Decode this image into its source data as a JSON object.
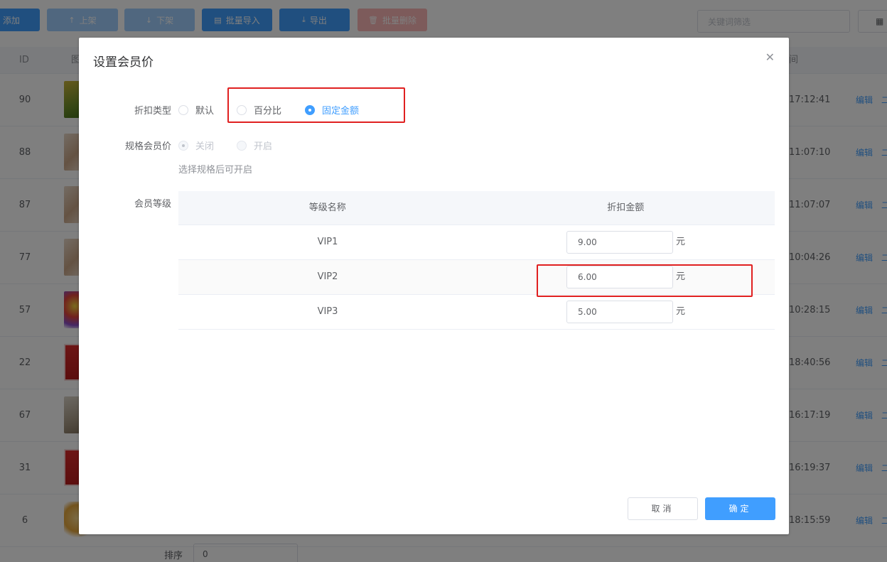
{
  "toolbar": {
    "add": "添加",
    "up": "上架",
    "down": "下架",
    "import": "批量导入",
    "export": "导出",
    "delete": "批量删除",
    "search_placeholder": "关键词筛选"
  },
  "table": {
    "col_id": "ID",
    "col_image": "图",
    "col_time": "间",
    "rows": [
      {
        "id": "90",
        "time": "17:12:41",
        "edit": "编辑",
        "more": "二"
      },
      {
        "id": "88",
        "time": "11:07:10",
        "edit": "编辑",
        "more": "二"
      },
      {
        "id": "87",
        "time": "11:07:07",
        "edit": "编辑",
        "more": "二"
      },
      {
        "id": "77",
        "time": "10:04:26",
        "edit": "编辑",
        "more": "二"
      },
      {
        "id": "57",
        "time": "10:28:15",
        "edit": "编辑",
        "more": "二"
      },
      {
        "id": "22",
        "time": "18:40:56",
        "edit": "编辑",
        "more": "二"
      },
      {
        "id": "67",
        "time": "16:17:19",
        "edit": "编辑",
        "more": "二"
      },
      {
        "id": "31",
        "time": "16:19:37",
        "edit": "编辑",
        "more": "二"
      },
      {
        "id": "6",
        "time": "18:15:59",
        "edit": "编辑",
        "more": "二"
      }
    ]
  },
  "bottom": {
    "sort_label": "排序",
    "sort_value": "0"
  },
  "dialog": {
    "title": "设置会员价",
    "discount_type_label": "折扣类型",
    "discount_options": [
      "默认",
      "百分比",
      "固定金额"
    ],
    "discount_selected": "固定金额",
    "spec_label": "规格会员价",
    "spec_options": [
      "关闭",
      "开启"
    ],
    "spec_selected": "关闭",
    "spec_hint": "选择规格后可开启",
    "level_label": "会员等级",
    "level_table": {
      "headers": [
        "等级名称",
        "折扣金额"
      ],
      "rows": [
        {
          "name": "VIP1",
          "amount": "9.00",
          "unit": "元"
        },
        {
          "name": "VIP2",
          "amount": "6.00",
          "unit": "元"
        },
        {
          "name": "VIP3",
          "amount": "5.00",
          "unit": "元"
        }
      ]
    },
    "cancel": "取消",
    "confirm": "确定"
  },
  "colors": {
    "primary": "#409eff",
    "annotation": "#e02020"
  }
}
